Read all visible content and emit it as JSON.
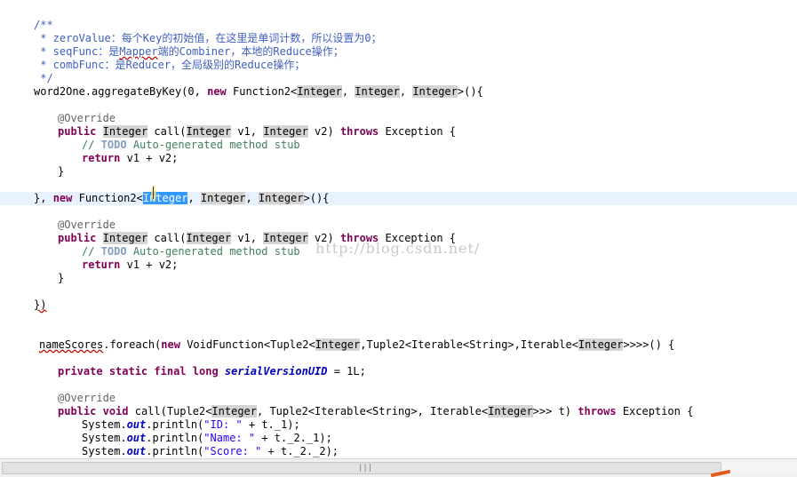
{
  "code": {
    "c1": "/**",
    "c2": " * zeroValue：每个Key的初始值，在这里是单词计数，所以设置为0；",
    "c3_pre": " * seqFunc：是",
    "c3_u": "Mapper",
    "c3_post": "端的Combiner，本地的Reduce操作；",
    "c4": " * combFunc：是Reducer，全局级别的Reduce操作；",
    "c5": " */",
    "l6_a": "word2One.aggregateByKey(0, ",
    "kw_new": "new",
    "fn2": " Function2<",
    "ty_integer": "Integer",
    "comma": ", ",
    "gen_close": ">(){",
    "ann_override": "@Override",
    "kw_public": "public",
    "call_open": " call(",
    "v1": " v1, ",
    "v2": " v2) ",
    "kw_throws": "throws",
    "exception": " Exception {",
    "todo_pre": "// ",
    "todo": "TODO",
    "todo_post": " Auto-generated method stub",
    "kw_return": "return",
    "ret_expr": " v1 + v2;",
    "close_brace": "}",
    "l16_pre": "}, ",
    "l23": "})",
    "foreach_name": "nameScores",
    "foreach_a": ".foreach(",
    "foreach_b": " VoidFunction<Tuple2<",
    "foreach_c": ",Tuple2<Iterable<String>,Iterable<",
    "foreach_d": ">>>>() {",
    "kw_private": "private",
    "kw_static": "static",
    "kw_final": "final",
    "kw_long": "long",
    "serial": "serialVersionUID",
    "serial_val": " = 1L;",
    "kw_void": "void",
    "call2_a": " call(Tuple2<",
    "call2_b": ", Tuple2<Iterable<String>, Iterable<",
    "call2_c": ">>> t) ",
    "sys": "System.",
    "out": "out",
    "println": ".println(",
    "s_id": "\"ID: \"",
    "s_name": "\"Name: \"",
    "s_score": "\"Score: \"",
    "p_id": " + t._1);",
    "p_name": " + t._2._1);",
    "p_score": " + t._2._2);"
  },
  "watermark": "http://blog.csdn.net/",
  "scrollbar": {
    "grip": "|||"
  }
}
